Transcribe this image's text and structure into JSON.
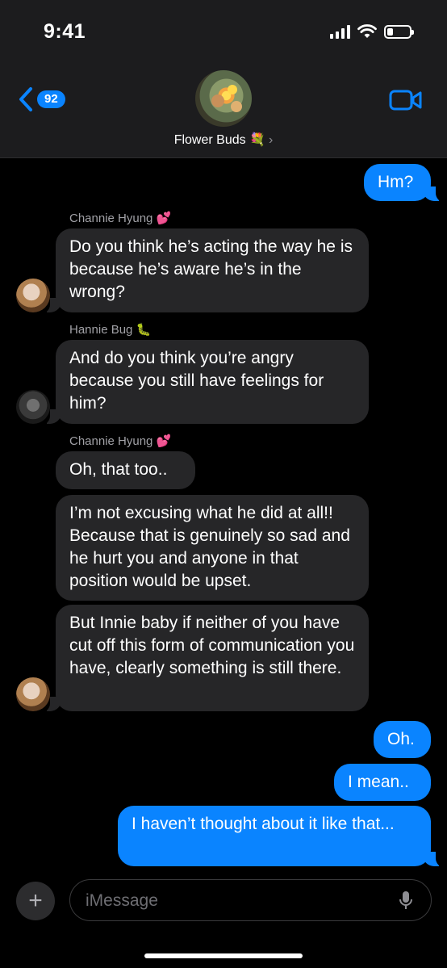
{
  "status_bar": {
    "time": "9:41"
  },
  "header": {
    "back_count": "92",
    "group_name": "Flower Buds 💐",
    "chevron": "›"
  },
  "messages": [
    {
      "dir": "out",
      "text": "Hm?"
    },
    {
      "dir": "in",
      "sender": "Channie Hyung 💕",
      "text": "Do you think he’s acting the way he is because he’s aware he’s in the wrong?"
    },
    {
      "dir": "in",
      "sender": "Hannie Bug 🐛",
      "text": "And do you think you’re angry because you still have feelings for him?"
    },
    {
      "dir": "in",
      "sender": "Channie Hyung 💕",
      "text": "Oh, that too.."
    },
    {
      "dir": "in",
      "text": "I’m not excusing what he did at all!! Because that is genuinely so sad and he hurt you and anyone in that position would be upset."
    },
    {
      "dir": "in",
      "text": "But Innie baby if neither of you have cut off this form of communication you have, clearly something is still there."
    },
    {
      "dir": "out",
      "text": "Oh."
    },
    {
      "dir": "out",
      "text": "I mean.."
    },
    {
      "dir": "out",
      "text": "I haven’t thought about it like that..."
    }
  ],
  "input": {
    "placeholder": "iMessage",
    "plus_label": "+"
  },
  "colors": {
    "accent": "#0a84ff",
    "incoming_bubble": "#262628",
    "background": "#000000"
  },
  "icons": [
    "back-chevron-icon",
    "video-camera-icon",
    "plus-icon",
    "microphone-icon",
    "signal-icon",
    "wifi-icon",
    "battery-icon"
  ]
}
